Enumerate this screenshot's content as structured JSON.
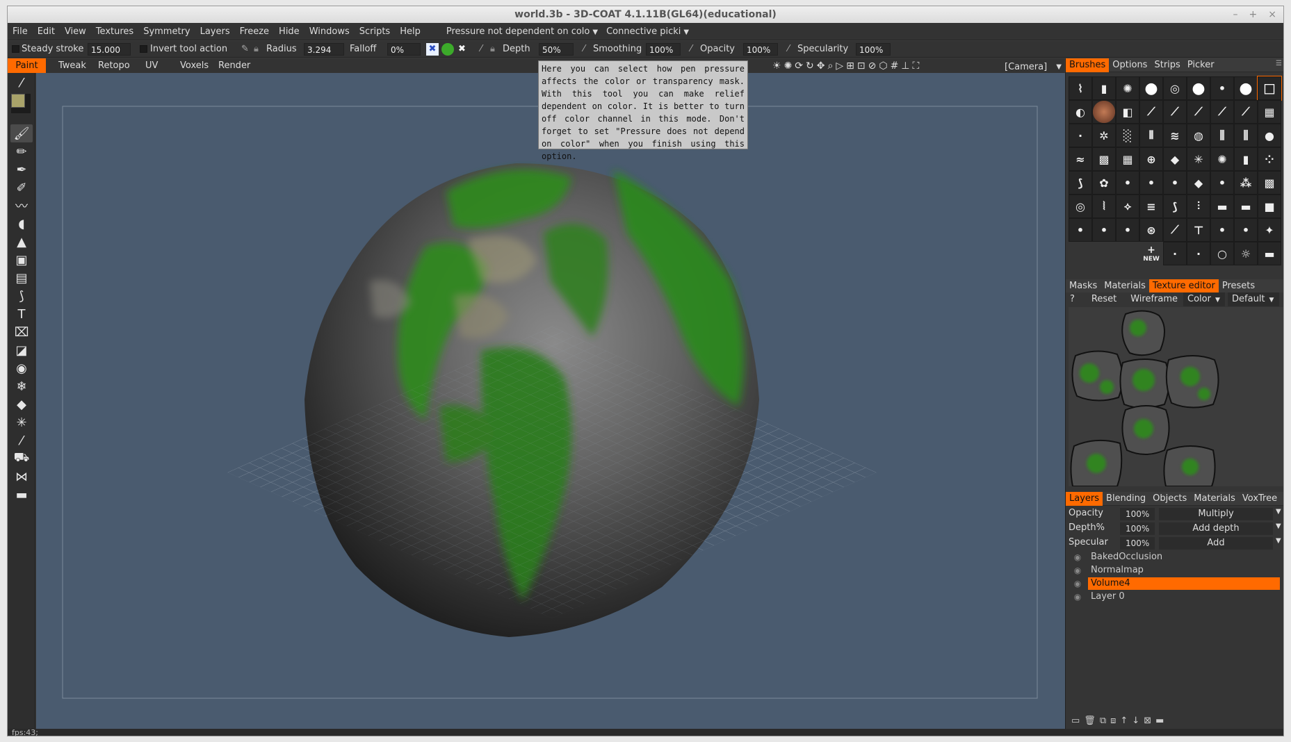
{
  "window": {
    "title": "world.3b - 3D-COAT 4.1.11B(GL64)(educational)",
    "controls": [
      "–",
      "+",
      "×"
    ]
  },
  "menu": [
    "File",
    "Edit",
    "View",
    "Textures",
    "Symmetry",
    "Layers",
    "Freeze",
    "Hide",
    "Windows",
    "Scripts",
    "Help"
  ],
  "pressure_combo": "Pressure not dependent on colo",
  "connective_combo": "Connective picki",
  "toolbar": {
    "steady_label": "Steady stroke",
    "steady_value": "15.000",
    "invert_label": "Invert tool action",
    "radius_label": "Radius",
    "radius_value": "3.294",
    "falloff_label": "Falloff",
    "falloff_value": "0%",
    "depth_label": "Depth",
    "depth_value": "50%",
    "smoothing_label": "Smoothing",
    "smoothing_value": "100%",
    "opacity_label": "Opacity",
    "opacity_value": "100%",
    "specularity_label": "Specularity",
    "specularity_value": "100%"
  },
  "rooms": [
    "Paint",
    "Tweak",
    "Retopo",
    "UV",
    "Voxels",
    "Render"
  ],
  "active_room": "Paint",
  "tooltip": "Here you can select how pen pressure affects the color or transparency mask. With this tool you can make relief dependent on color. It is better to turn off color channel in this mode. Don't forget to set \"Pressure does not depend on color\" when you finish using this option.",
  "camera_label": "[Camera]",
  "brush_tabs": [
    "Brushes",
    "Options",
    "Strips",
    "Picker"
  ],
  "brush_new_label": "NEW",
  "texture_tabs": [
    "Masks",
    "Materials",
    "Texture editor",
    "Presets"
  ],
  "texture_toolbar": {
    "help": "?",
    "reset": "Reset",
    "wireframe": "Wireframe",
    "color": "Color",
    "preset": "Default"
  },
  "layer_tabs": [
    "Layers",
    "Blending",
    "Objects",
    "Materials",
    "VoxTree"
  ],
  "layer_props": [
    {
      "label": "Opacity",
      "value": "100%",
      "mode": "Multiply"
    },
    {
      "label": "Depth%",
      "value": "100%",
      "mode": "Add depth"
    },
    {
      "label": "Specular",
      "value": "100%",
      "mode": "Add"
    }
  ],
  "layers": [
    "BakedOcclusion",
    "Normalmap",
    "Volume4",
    "Layer 0"
  ],
  "active_layer": "Volume4",
  "status": "fps:43;",
  "colors": {
    "accent": "#ff6a00",
    "viewport_bg": "#4a5b6f",
    "primary_color": "#a9a36a",
    "moss_green": "#2f8a1e",
    "rock_gray": "#5a5a5a"
  }
}
